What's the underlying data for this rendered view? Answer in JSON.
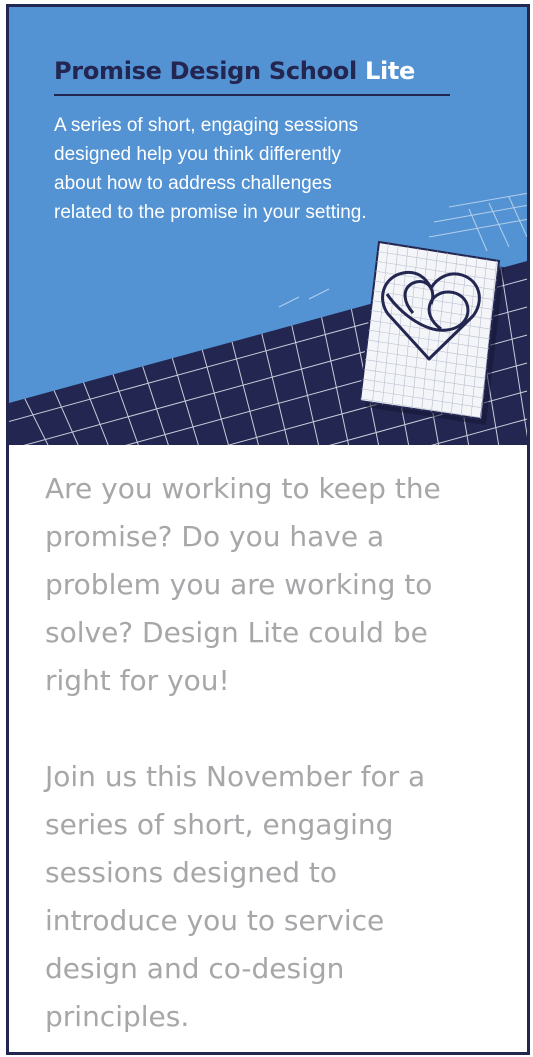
{
  "header": {
    "title_main": "Promise Design School",
    "title_accent": "Lite",
    "subtitle_lines": [
      "A series of short, engaging sessions",
      "designed help you think differently",
      "about how to address challenges",
      "related to the promise in your setting."
    ]
  },
  "illustration": {
    "icon": "heart-on-grid-paper-icon"
  },
  "body": {
    "paragraph1_lines": [
      "Are you working to keep the",
      "promise? Do you have a",
      "problem you are working to",
      "solve? Design Lite could be",
      "right for you!"
    ],
    "paragraph2_lines": [
      "Join us this November for a",
      "series of short, engaging",
      "sessions designed to",
      "introduce you to service",
      "design and co-design",
      "principles."
    ]
  },
  "colors": {
    "navy": "#232650",
    "hero_blue": "#5493d3",
    "body_text": "#a7a7aa",
    "white": "#ffffff"
  }
}
